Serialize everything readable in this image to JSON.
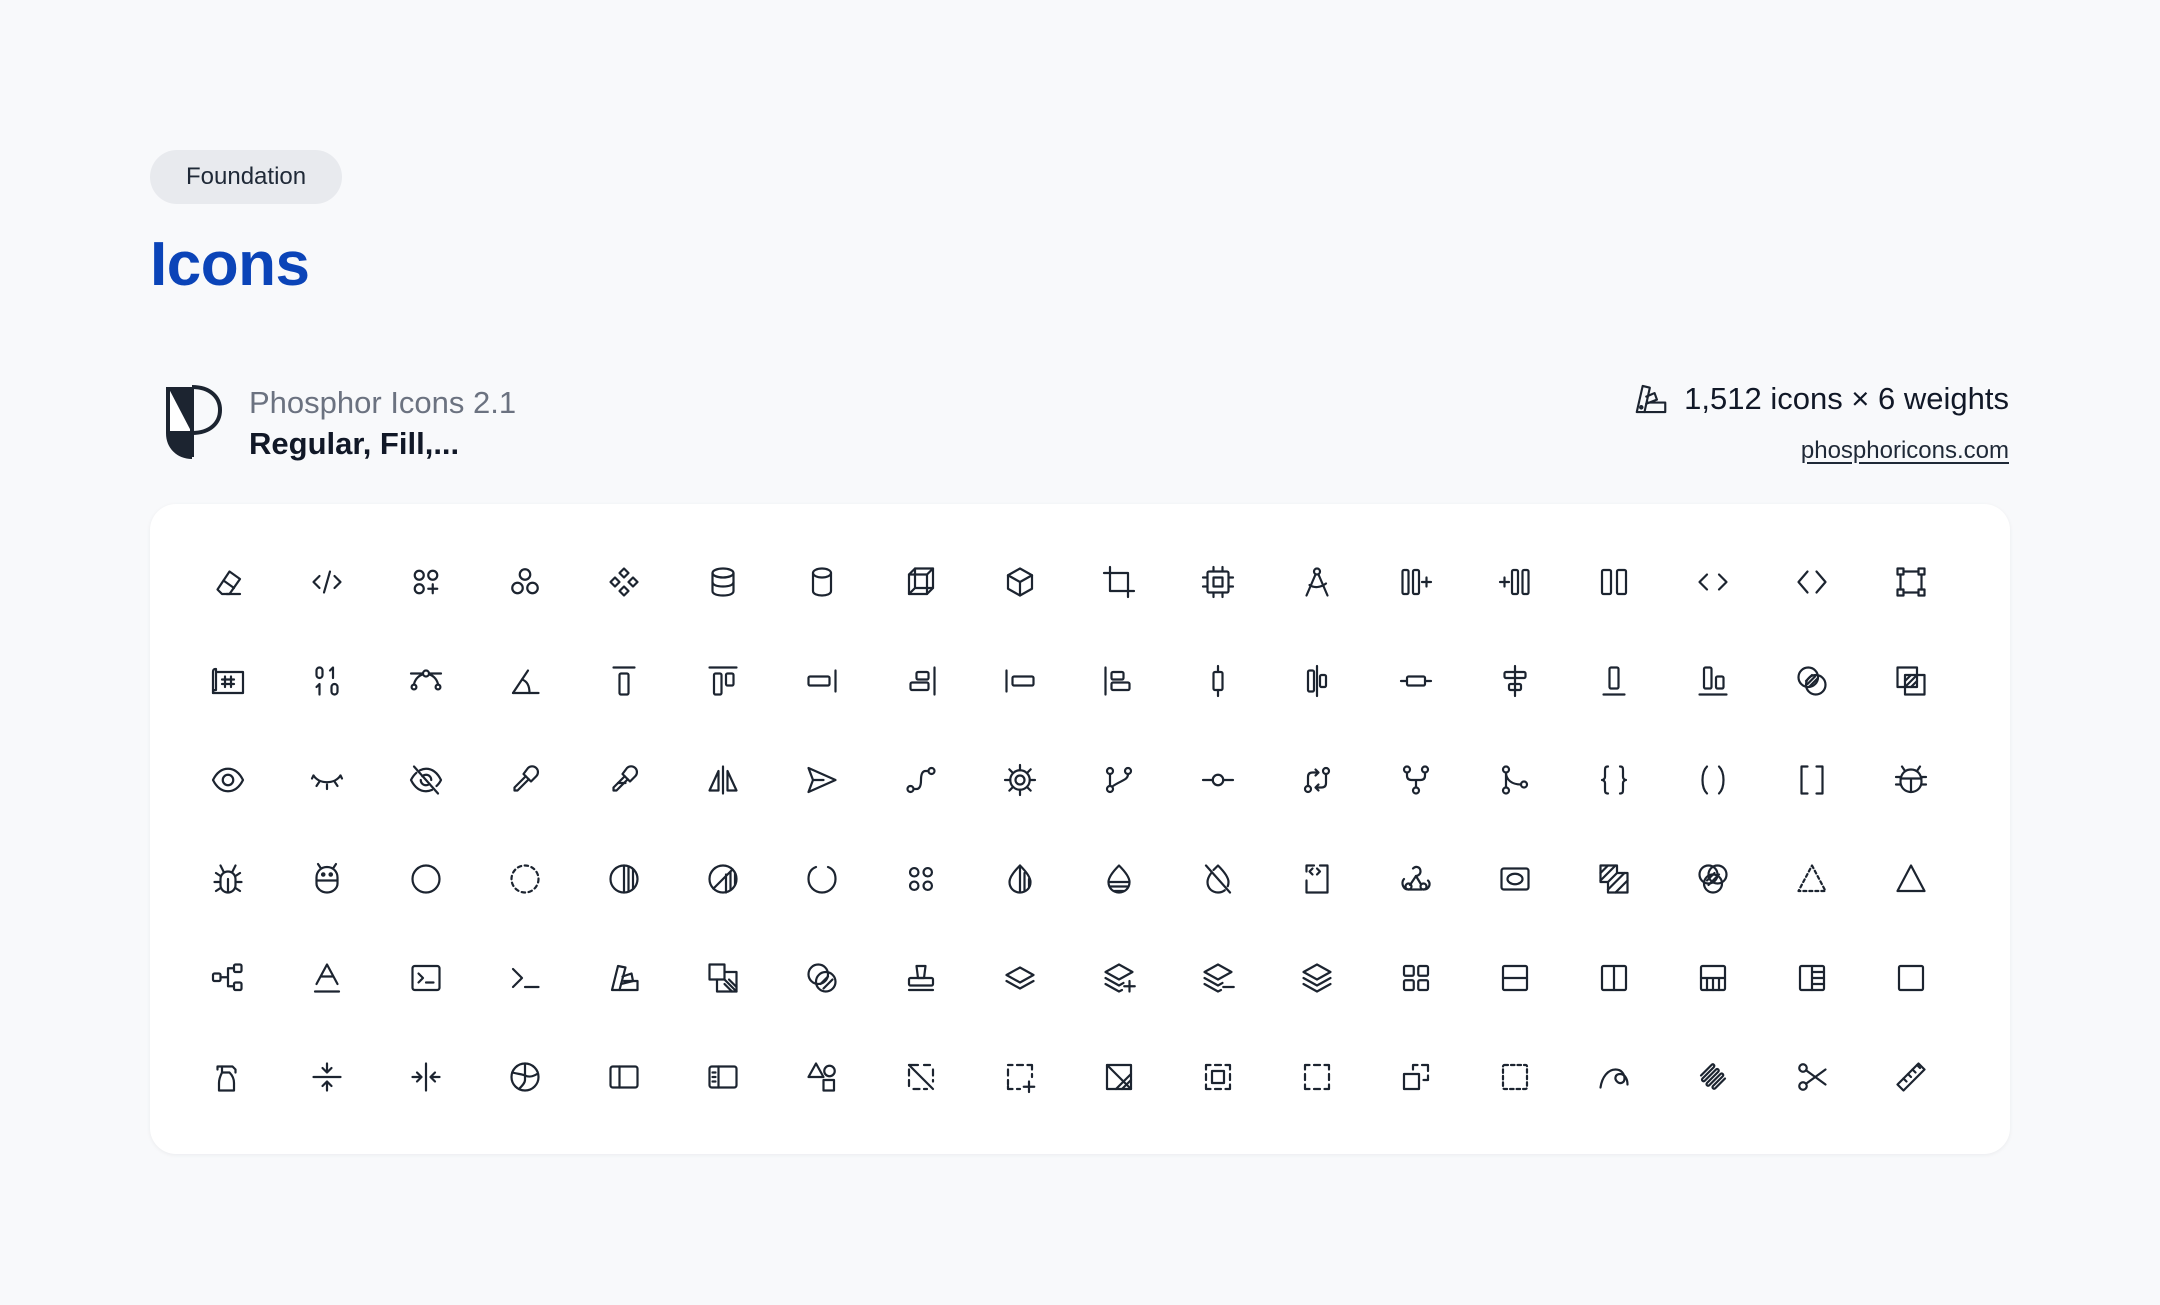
{
  "badge": "Foundation",
  "title": "Icons",
  "library": {
    "name": "Phosphor Icons 2.1",
    "weights_label": "Regular, Fill,...",
    "stats": "1,512 icons × 6 weights",
    "site": "phosphoricons.com"
  },
  "colors": {
    "accent": "#0b44b8",
    "icon": "#1c2430",
    "background": "#f8f9fb",
    "card": "#ffffff"
  },
  "icons": [
    [
      "eraser-icon",
      "code-slash-icon",
      "shapes-plus-icon",
      "circles-three-icon",
      "diamonds-four-icon",
      "database-icon",
      "cylinder-icon",
      "cube-transparent-icon",
      "cube-icon",
      "crop-icon",
      "cpu-icon",
      "compass-tool-icon",
      "columns-plus-right-icon",
      "columns-plus-left-icon",
      "columns-icon",
      "code-icon",
      "code-simple-icon",
      "bounding-box-icon"
    ],
    [
      "blueprint-icon",
      "binary-icon",
      "bezier-curve-icon",
      "angle-icon",
      "align-top-simple-icon",
      "align-top-icon",
      "align-right-simple-icon",
      "align-right-icon",
      "align-left-simple-icon",
      "align-left-icon",
      "align-center-vertical-simple-icon",
      "align-center-vertical-icon",
      "align-center-horizontal-simple-icon",
      "align-center-horizontal-icon",
      "align-bottom-simple-icon",
      "align-bottom-icon",
      "intersect-circle-icon",
      "intersect-square-icon"
    ],
    [
      "eye-icon",
      "eye-closed-icon",
      "eye-slash-icon",
      "eyedropper-icon",
      "eyedropper-sample-icon",
      "flip-horizontal-icon",
      "paper-plane-icon",
      "path-icon",
      "gear-fine-icon",
      "git-branch-icon",
      "git-commit-icon",
      "git-diff-icon",
      "git-fork-icon",
      "git-merge-icon",
      "brackets-curly-icon",
      "brackets-round-icon",
      "brackets-square-icon",
      "bug-beetle-icon"
    ],
    [
      "bug-icon",
      "bug-droid-icon",
      "circle-icon",
      "circle-dashed-icon",
      "circle-half-icon",
      "circle-half-tilt-icon",
      "circle-notch-icon",
      "dots-four-icon",
      "drop-half-icon",
      "drop-half-bottom-icon",
      "drop-slash-icon",
      "file-code-icon",
      "webhooks-logo-icon",
      "frame-corners-icon",
      "selection-background-icon",
      "intersect-three-icon",
      "triangle-dashed-icon",
      "triangle-icon"
    ],
    [
      "tree-structure-icon",
      "text-a-underline-icon",
      "terminal-window-icon",
      "terminal-icon",
      "swatches-icon",
      "selection-foreground-icon",
      "exclude-icon",
      "stamp-icon",
      "stack-simple-icon",
      "stack-plus-icon",
      "stack-minus-icon",
      "stack-icon",
      "squares-four-icon",
      "square-split-vertical-icon",
      "square-split-horizontal-icon",
      "square-half-bottom-icon",
      "square-half-icon",
      "square-icon"
    ],
    [
      "spray-bottle-icon",
      "split-vertical-icon",
      "split-horizontal-icon",
      "globe-hemisphere-icon",
      "sidebar-simple-icon",
      "sidebar-icon",
      "shapes-icon",
      "selection-slash-icon",
      "selection-plus-icon",
      "selection-inverse-icon",
      "selection-all-icon",
      "selection-icon",
      "selection-foreground-alt-icon",
      "selection-dashed-icon",
      "scribble-loop-icon",
      "scribble-icon",
      "scissors-icon",
      "ruler-icon"
    ]
  ]
}
